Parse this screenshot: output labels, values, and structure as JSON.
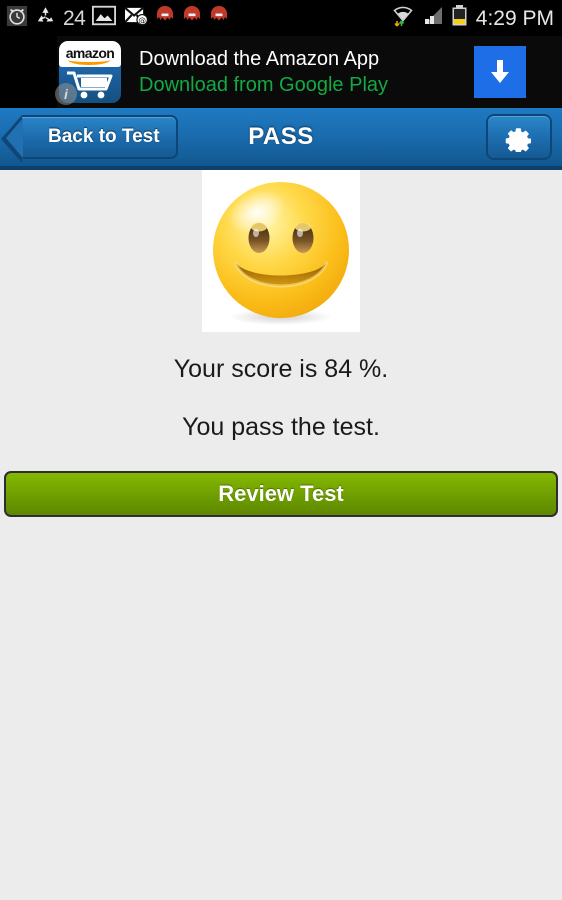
{
  "status_bar": {
    "icons": [
      {
        "name": "alarm-clock-icon",
        "glyph": "alarm"
      },
      {
        "name": "recycle-icon",
        "glyph": "recycle"
      },
      {
        "name": "photo-icon",
        "glyph": "photo"
      },
      {
        "name": "email-icon",
        "glyph": "email"
      },
      {
        "name": "octopus-notification-icon",
        "glyph": "octopus"
      },
      {
        "name": "octopus-notification-icon",
        "glyph": "octopus"
      },
      {
        "name": "octopus-notification-icon",
        "glyph": "octopus"
      }
    ],
    "notification_count": "24",
    "wifi_label": "wifi-icon",
    "signal_label": "signal-icon",
    "battery_label": "battery-icon",
    "clock": "4:29 PM"
  },
  "ad": {
    "brand": "amazon",
    "title": "Download the Amazon App",
    "subtitle": "Download from Google Play",
    "info_badge": "i",
    "cta_icon": "download-arrow-icon",
    "title_color": "#ffffff",
    "subtitle_color": "#13a943",
    "cta_color": "#1e6ee8"
  },
  "header": {
    "back_label": "Back to Test",
    "title": "PASS",
    "settings_icon": "gear-icon",
    "background_color": "#1a6cae"
  },
  "result": {
    "image_name": "smiley-face-image",
    "image_alt": "happy-smiley-face",
    "score_text": "Your score is 84 %.",
    "score_value": 84,
    "pass_text": "You pass the test.",
    "review_button_label": "Review Test",
    "review_button_color": "#72a300"
  }
}
